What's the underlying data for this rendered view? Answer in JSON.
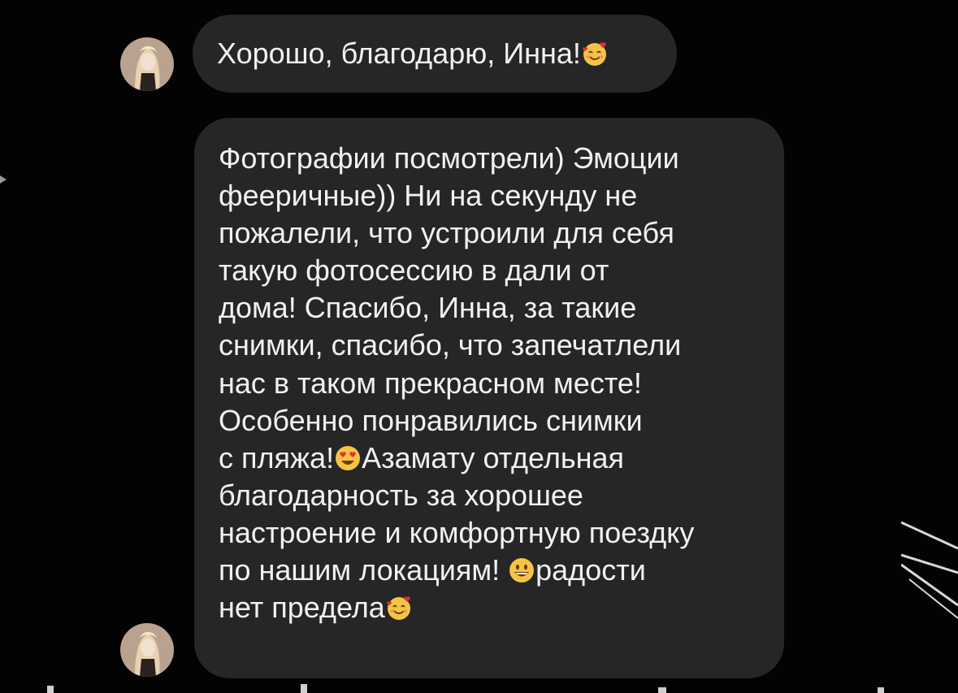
{
  "thread": {
    "messages": [
      {
        "sender_avatar": "avatar",
        "lines": [
          {
            "text": "Хорошо, благодарю, Инна!",
            "emoji": "smiling-face-with-hearts"
          }
        ]
      },
      {
        "sender_avatar": "avatar",
        "lines": [
          {
            "text": "Фотографии посмотрели) Эмоции"
          },
          {
            "text": "фееричные)) Ни на секунду не"
          },
          {
            "text": "пожалели, что устроили для себя"
          },
          {
            "text": "такую фотосессию в дали от"
          },
          {
            "text": "дома! Спасибо, Инна, за такие"
          },
          {
            "text": "снимки, спасибо, что запечатлели"
          },
          {
            "text": "нас в таком прекрасном месте!"
          },
          {
            "text": "Особенно понравились снимки"
          },
          {
            "before": "с пляжа!",
            "emoji": "heart-eyes",
            "after": "Азамату отдельная"
          },
          {
            "text": "благодарность за хорошее"
          },
          {
            "text": "настроение и комфортную поездку"
          },
          {
            "before": "по нашим локациям! ",
            "emoji": "grinning-face",
            "after": "радости"
          },
          {
            "before": "нет предела",
            "emoji": "smiling-face-with-hearts",
            "after": ""
          }
        ]
      }
    ]
  },
  "colors": {
    "background": "#030303",
    "bubble": "#262626",
    "text": "#f1f1f1"
  }
}
